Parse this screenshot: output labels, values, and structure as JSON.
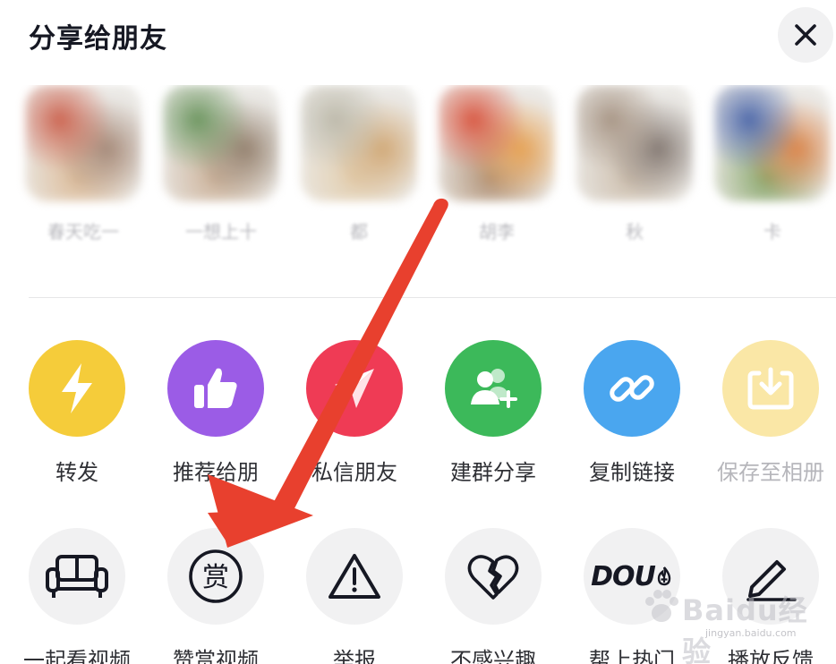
{
  "header": {
    "title": "分享给朋友",
    "close_icon": "close-icon"
  },
  "friends": [
    {
      "name": "春天吃一",
      "colors": [
        "#c7553f",
        "#9d7f6d",
        "#d9b58f"
      ]
    },
    {
      "name": "一想上十",
      "colors": [
        "#5e8b4f",
        "#8a7561",
        "#c7aa8f"
      ]
    },
    {
      "name": "都",
      "colors": [
        "#b7b3a2",
        "#cda16b",
        "#e0c9a6"
      ]
    },
    {
      "name": "胡李",
      "colors": [
        "#d5472f",
        "#e59a45",
        "#a88566"
      ]
    },
    {
      "name": "秋",
      "colors": [
        "#9f8b79",
        "#7a6e67",
        "#c9b9a6"
      ]
    },
    {
      "name": "卡",
      "colors": [
        "#3d5aa1",
        "#d87a3b",
        "#7c9d5b"
      ]
    }
  ],
  "actions_row_1": [
    {
      "label": "转发",
      "icon": "lightning-icon",
      "color": "#f5cc3a",
      "dimmed": false
    },
    {
      "label": "推荐给朋",
      "icon": "thumbs-up-icon",
      "color": "#9b5ce6",
      "dimmed": false
    },
    {
      "label": "私信朋友",
      "icon": "paper-plane-icon",
      "color": "#ef3b55",
      "dimmed": false
    },
    {
      "label": "建群分享",
      "icon": "add-group-icon",
      "color": "#3cb95a",
      "dimmed": false
    },
    {
      "label": "复制链接",
      "icon": "link-icon",
      "color": "#4aa6ef",
      "dimmed": false
    },
    {
      "label": "保存至相册",
      "icon": "download-icon",
      "color": "#fae7a6",
      "dimmed": true
    }
  ],
  "actions_row_2": [
    {
      "label": "一起看视频",
      "icon": "sofa-icon"
    },
    {
      "label": "赞赏视频",
      "icon": "reward-icon",
      "icon_text": "赏"
    },
    {
      "label": "举报",
      "icon": "warning-icon"
    },
    {
      "label": "不感兴趣",
      "icon": "broken-heart-icon"
    },
    {
      "label": "帮上热门",
      "icon": "dou-plus-icon",
      "icon_text": "DOU"
    },
    {
      "label": "播放反馈",
      "icon": "pencil-icon"
    }
  ],
  "annotation": {
    "arrow_color": "#e8402e"
  },
  "watermark": {
    "text": "Baidu经验",
    "sub": "jingyan.baidu.com"
  }
}
